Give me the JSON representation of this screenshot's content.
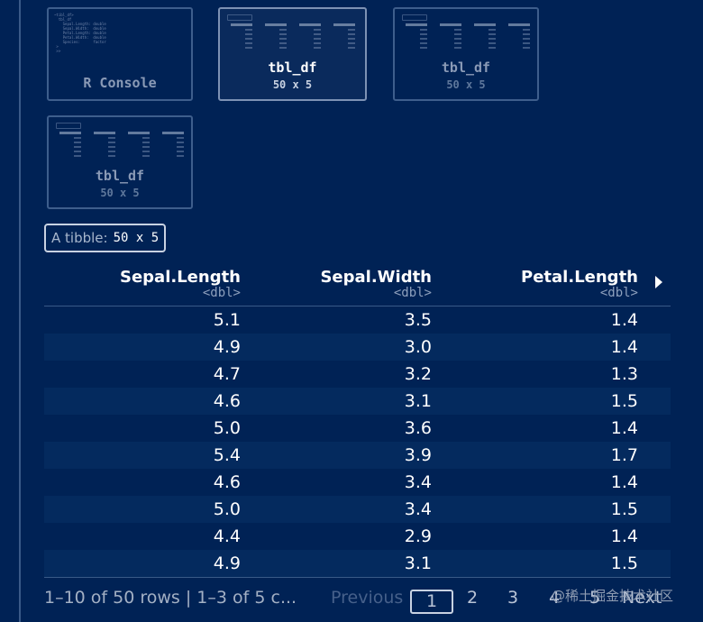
{
  "thumbnails": [
    {
      "title": "R Console",
      "subtitle": ""
    },
    {
      "title": "tbl_df",
      "subtitle": "50 x 5"
    },
    {
      "title": "tbl_df",
      "subtitle": "50 x 5"
    },
    {
      "title": "tbl_df",
      "subtitle": "50 x 5"
    }
  ],
  "badge": {
    "label": "A tibble:",
    "dims": "50 x 5"
  },
  "columns": [
    {
      "name": "Sepal.Length",
      "type": "<dbl>"
    },
    {
      "name": "Sepal.Width",
      "type": "<dbl>"
    },
    {
      "name": "Petal.Length",
      "type": "<dbl>"
    }
  ],
  "rows": [
    [
      "5.1",
      "3.5",
      "1.4"
    ],
    [
      "4.9",
      "3.0",
      "1.4"
    ],
    [
      "4.7",
      "3.2",
      "1.3"
    ],
    [
      "4.6",
      "3.1",
      "1.5"
    ],
    [
      "5.0",
      "3.6",
      "1.4"
    ],
    [
      "5.4",
      "3.9",
      "1.7"
    ],
    [
      "4.6",
      "3.4",
      "1.4"
    ],
    [
      "5.0",
      "3.4",
      "1.5"
    ],
    [
      "4.4",
      "2.9",
      "1.4"
    ],
    [
      "4.9",
      "3.1",
      "1.5"
    ]
  ],
  "footer": {
    "info": "1–10 of 50 rows | 1–3 of 5 c...",
    "previous": "Previous",
    "pages": [
      "1",
      "2",
      "3",
      "4",
      "5"
    ],
    "next": "Next"
  },
  "watermark": "@稀土掘金技术社区",
  "colors": {
    "background": "#002255",
    "accent": "#ffffff",
    "muted": "#a3b0c4"
  }
}
